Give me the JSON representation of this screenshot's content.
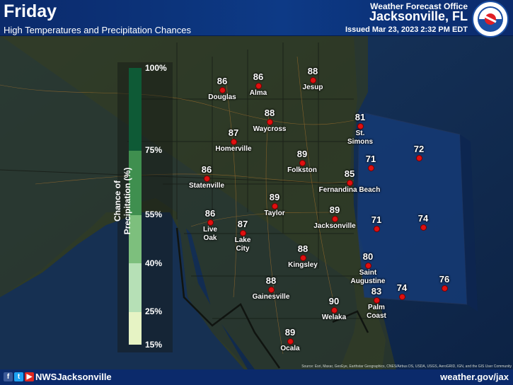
{
  "header": {
    "title": "Friday",
    "subtitle": "High Temperatures and Precipitation Chances",
    "office": "Weather Forecast Office",
    "city": "Jacksonville, FL",
    "issued": "Issued Mar 23, 2023 2:32 PM EDT",
    "logo_text": "NATIONAL WEATHER SERVICE"
  },
  "legend": {
    "title": "Chance of Precipitation (%)",
    "ticks": [
      "100%",
      "75%",
      "55%",
      "40%",
      "25%",
      "15%"
    ],
    "colors": [
      "#0e5a36",
      "#3f8f4f",
      "#7dbf7d",
      "#b6e0b6",
      "#e6f3c4"
    ]
  },
  "stations": [
    {
      "name": "Douglas",
      "temp": "86"
    },
    {
      "name": "Alma",
      "temp": "86"
    },
    {
      "name": "Jesup",
      "temp": "88"
    },
    {
      "name": "Waycross",
      "temp": "88"
    },
    {
      "name": "St. Simons",
      "temp": "81"
    },
    {
      "name": "Homerville",
      "temp": "87"
    },
    {
      "name": "Folkston",
      "temp": "89"
    },
    {
      "name": "Statenville",
      "temp": "86"
    },
    {
      "name": "Fernandina Beach",
      "temp": "85"
    },
    {
      "name": "Taylor",
      "temp": "89"
    },
    {
      "name": "Jacksonville",
      "temp": "89"
    },
    {
      "name": "Live Oak",
      "temp": "86"
    },
    {
      "name": "Lake City",
      "temp": "87"
    },
    {
      "name": "Kingsley",
      "temp": "88"
    },
    {
      "name": "Saint Augustine",
      "temp": "80"
    },
    {
      "name": "Gainesville",
      "temp": "88"
    },
    {
      "name": "Palm Coast",
      "temp": "83"
    },
    {
      "name": "Welaka",
      "temp": "90"
    },
    {
      "name": "Ocala",
      "temp": "89"
    }
  ],
  "marine": [
    {
      "temp": "71"
    },
    {
      "temp": "72"
    },
    {
      "temp": "71"
    },
    {
      "temp": "74"
    },
    {
      "temp": "74"
    },
    {
      "temp": "76"
    }
  ],
  "footer": {
    "handle": "NWSJacksonville",
    "website": "weather.gov/jax",
    "credit": "Source: Esri, Maxar, GeoEye, Earthstar Geographics, CNES/Airbus DS, USDA, USGS, AeroGRID, IGN, and the GIS User Community",
    "social_icons": [
      "facebook-icon",
      "twitter-icon",
      "youtube-icon"
    ]
  }
}
